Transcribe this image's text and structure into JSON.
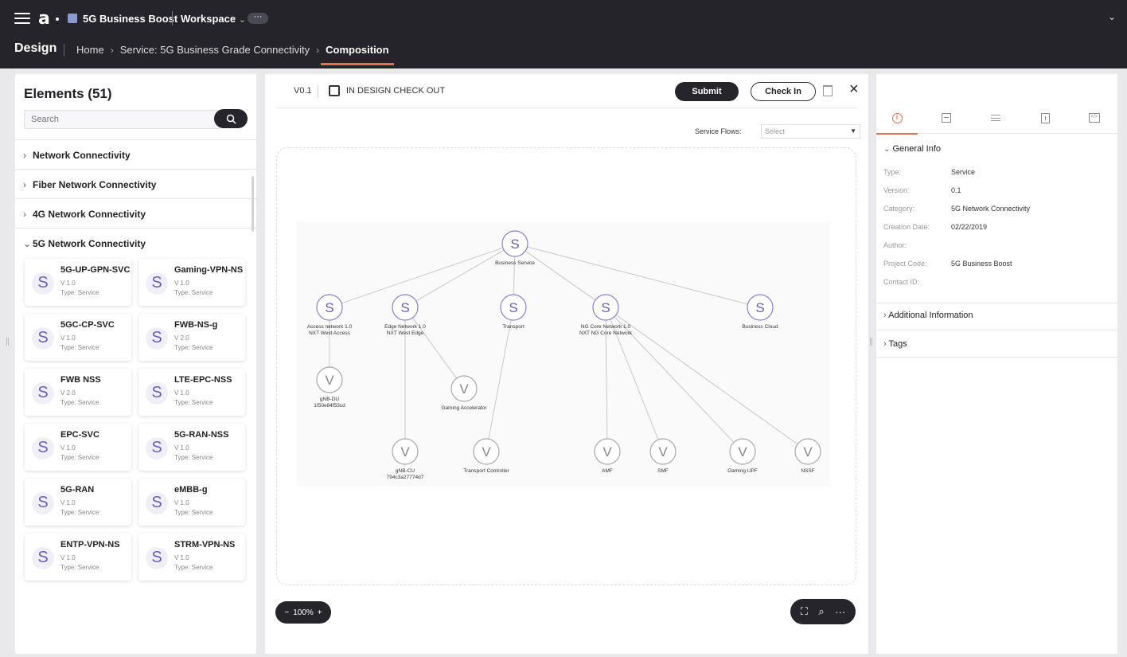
{
  "header": {
    "logo": "a",
    "project": "5G Business Boost",
    "workspace": "Workspace",
    "workspace_caret": "⌄",
    "more": "···",
    "collapse": "⌄",
    "section": "Design",
    "breadcrumbs": [
      "Home",
      "Service: 5G Business Grade Connectivity",
      "Composition"
    ],
    "crumb_sep": "›"
  },
  "elements_panel": {
    "title": "Elements (51)",
    "search_placeholder": "Search",
    "categories": [
      {
        "label": "Network Connectivity",
        "caret": "›"
      },
      {
        "label": "Fiber Network Connectivity",
        "caret": "›"
      },
      {
        "label": "4G Network Connectivity",
        "caret": "›"
      },
      {
        "label": "5G Network Connectivity",
        "caret": "⌄"
      }
    ],
    "cards": [
      {
        "icon": "S",
        "name": "5G-UP-GPN-SVC",
        "version": "V 1.0",
        "type": "Type: Service"
      },
      {
        "icon": "S",
        "name": "Gaming-VPN-NS",
        "version": "V 1.0",
        "type": "Type: Service"
      },
      {
        "icon": "S",
        "name": "5GC-CP-SVC",
        "version": "V 1.0",
        "type": "Type: Service"
      },
      {
        "icon": "S",
        "name": "FWB-NS-g",
        "version": "V 2.0",
        "type": "Type: Service"
      },
      {
        "icon": "S",
        "name": "FWB NSS",
        "version": "V 2.0",
        "type": "Type: Service"
      },
      {
        "icon": "S",
        "name": "LTE-EPC-NSS",
        "version": "V 1.0",
        "type": "Type: Service"
      },
      {
        "icon": "S",
        "name": "EPC-SVC",
        "version": "V 1.0",
        "type": "Type: Service"
      },
      {
        "icon": "S",
        "name": "5G-RAN-NSS",
        "version": "V 1.0",
        "type": "Type: Service"
      },
      {
        "icon": "S",
        "name": "5G-RAN",
        "version": "V 1.0",
        "type": "Type: Service"
      },
      {
        "icon": "S",
        "name": "eMBB-g",
        "version": "V 1.0",
        "type": "Type: Service"
      },
      {
        "icon": "S",
        "name": "ENTP-VPN-NS",
        "version": "V 1.0",
        "type": "Type: Service"
      },
      {
        "icon": "S",
        "name": "STRM-VPN-NS",
        "version": "V 1.0",
        "type": "Type: Service"
      }
    ]
  },
  "canvas": {
    "version": "V0.1",
    "status": "IN DESIGN CHECK OUT",
    "submit_label": "Submit",
    "checkin_label": "Check In",
    "close": "×",
    "flows_label": "Service Flows:",
    "flows_value": "Select",
    "zoom_minus": "−",
    "zoom_level": "100%",
    "zoom_plus": "+",
    "tool_fit": "⛶",
    "tool_search": "⌕",
    "tool_more": "···",
    "nodes": [
      {
        "id": "business-service",
        "icon": "S",
        "label": "Business Service"
      },
      {
        "id": "access-network",
        "icon": "S",
        "label": "Access network 1.0",
        "label2": "NXT West Access"
      },
      {
        "id": "edge-network",
        "icon": "S",
        "label": "Edge Network 1.0",
        "label2": "NXT West Edge"
      },
      {
        "id": "transport",
        "icon": "S",
        "label": "Transport"
      },
      {
        "id": "ng-core-network",
        "icon": "S",
        "label": "NG Core Network 1.0",
        "label2": "NXT NG Core Network"
      },
      {
        "id": "business-cloud",
        "icon": "S",
        "label": "Business Cloud"
      },
      {
        "id": "gnb-du",
        "icon": "V",
        "label": "gNB-DU",
        "label2": "1f50e84f53cd"
      },
      {
        "id": "gaming-accelerator",
        "icon": "V",
        "label": "Gaming Accelerator"
      },
      {
        "id": "gnb-cu",
        "icon": "V",
        "label": "gNB-CU",
        "label2": "794c3a27774d7"
      },
      {
        "id": "transport-controller",
        "icon": "V",
        "label": "Transport Controller"
      },
      {
        "id": "amf",
        "icon": "V",
        "label": "AMF"
      },
      {
        "id": "smf",
        "icon": "V",
        "label": "SMF"
      },
      {
        "id": "gaming-upf",
        "icon": "V",
        "label": "Gaming UPF"
      },
      {
        "id": "nssf",
        "icon": "V",
        "label": "NSSF"
      }
    ],
    "edges": [
      [
        "business-service",
        "access-network"
      ],
      [
        "business-service",
        "edge-network"
      ],
      [
        "business-service",
        "transport"
      ],
      [
        "business-service",
        "ng-core-network"
      ],
      [
        "business-service",
        "business-cloud"
      ],
      [
        "access-network",
        "gnb-du"
      ],
      [
        "edge-network",
        "gaming-accelerator"
      ],
      [
        "edge-network",
        "gnb-cu"
      ],
      [
        "transport",
        "transport-controller"
      ],
      [
        "ng-core-network",
        "amf"
      ],
      [
        "ng-core-network",
        "smf"
      ],
      [
        "ng-core-network",
        "gaming-upf"
      ],
      [
        "ng-core-network",
        "nssf"
      ]
    ]
  },
  "properties_panel": {
    "general_info_title": "General Info",
    "general_caret": "⌄",
    "fields": [
      {
        "key": "Type:",
        "value": "Service"
      },
      {
        "key": "Version:",
        "value": "0.1"
      },
      {
        "key": "Category:",
        "value": "5G Network Connectivity"
      },
      {
        "key": "Creation Date:",
        "value": "02/22/2019"
      },
      {
        "key": "Author:",
        "value": ""
      },
      {
        "key": "Project Code:",
        "value": "5G Business Boost"
      },
      {
        "key": "Contact ID:",
        "value": ""
      }
    ],
    "additional_info": "Additional Information",
    "tags": "Tags",
    "closed_caret": "›"
  },
  "colors": {
    "topbar": "#24242a",
    "accent": "#ef6c4a",
    "node_purple": "#6a5fbd",
    "button_dark": "#25252b"
  }
}
